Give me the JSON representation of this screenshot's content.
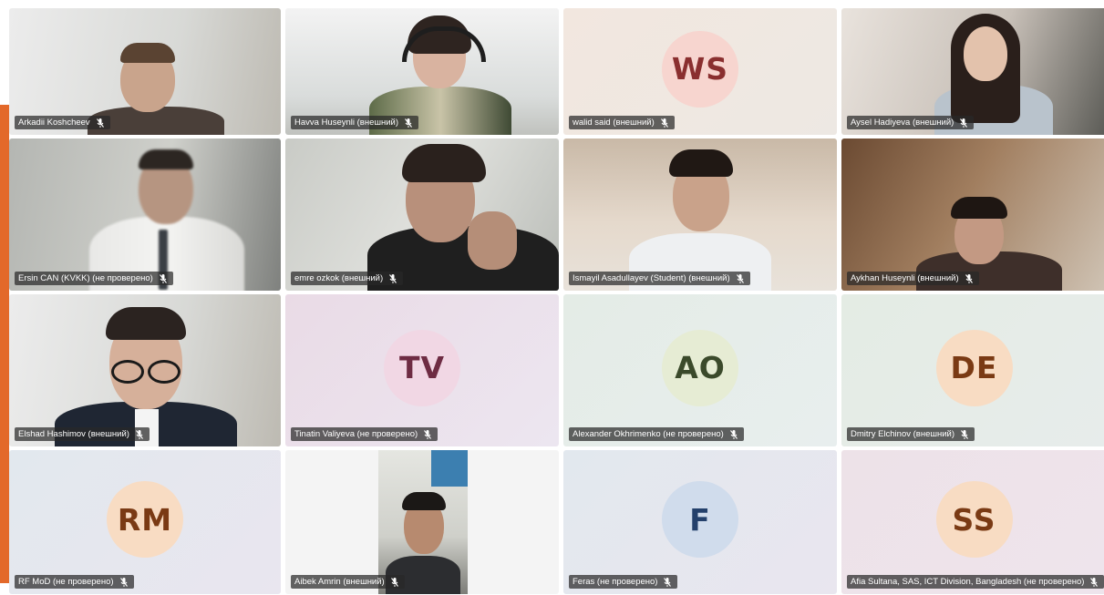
{
  "participants": [
    {
      "name": "Arkadii Koshcheev",
      "kind": "video"
    },
    {
      "name": "Havva Huseynli (внешний)",
      "kind": "video"
    },
    {
      "name": "walid said (внешний)",
      "kind": "avatar",
      "initials": "WS",
      "circle_color": "#f7d5cf",
      "text_color": "#8a2f2f"
    },
    {
      "name": "Aysel Hadiyeva (внешний)",
      "kind": "video"
    },
    {
      "name": "Ersin CAN (KVKK) (не проверено)",
      "kind": "video"
    },
    {
      "name": "emre ozkok (внешний)",
      "kind": "video"
    },
    {
      "name": "Ismayil Asadullayev (Student) (внешний)",
      "kind": "video"
    },
    {
      "name": "Aykhan Huseynli (внешний)",
      "kind": "video"
    },
    {
      "name": "Elshad Hashimov (внешний)",
      "kind": "video"
    },
    {
      "name": "Tinatin Valiyeva (не проверено)",
      "kind": "avatar",
      "initials": "TV",
      "circle_color": "#f1d7e4",
      "text_color": "#6e2c43"
    },
    {
      "name": "Alexander Okhrimenko (не проверено)",
      "kind": "avatar",
      "initials": "AO",
      "circle_color": "#e6ecd4",
      "text_color": "#3b4a2b"
    },
    {
      "name": "Dmitry Elchinov (внешний)",
      "kind": "avatar",
      "initials": "DE",
      "circle_color": "#f8dcc3",
      "text_color": "#7a3a14"
    },
    {
      "name": "RF MoD (не проверено)",
      "kind": "avatar",
      "initials": "RM",
      "circle_color": "#f8dcc3",
      "text_color": "#7a3a14"
    },
    {
      "name": "Aibek Amrin (внешний)",
      "kind": "video"
    },
    {
      "name": "Feras (не проверено)",
      "kind": "avatar",
      "initials": "F",
      "circle_color": "#d0dcec",
      "text_color": "#23406b"
    },
    {
      "name": "Afia Sultana, SAS, ICT Division, Bangladesh (не проверено)",
      "kind": "avatar",
      "initials": "SS",
      "circle_color": "#f8dcc3",
      "text_color": "#7a3a14"
    }
  ],
  "colors": {
    "accent_bar": "#e3692a",
    "name_tag_bg": "rgba(40,40,40,0.72)"
  },
  "icons": {
    "muted_mic": "mic-off-icon"
  }
}
